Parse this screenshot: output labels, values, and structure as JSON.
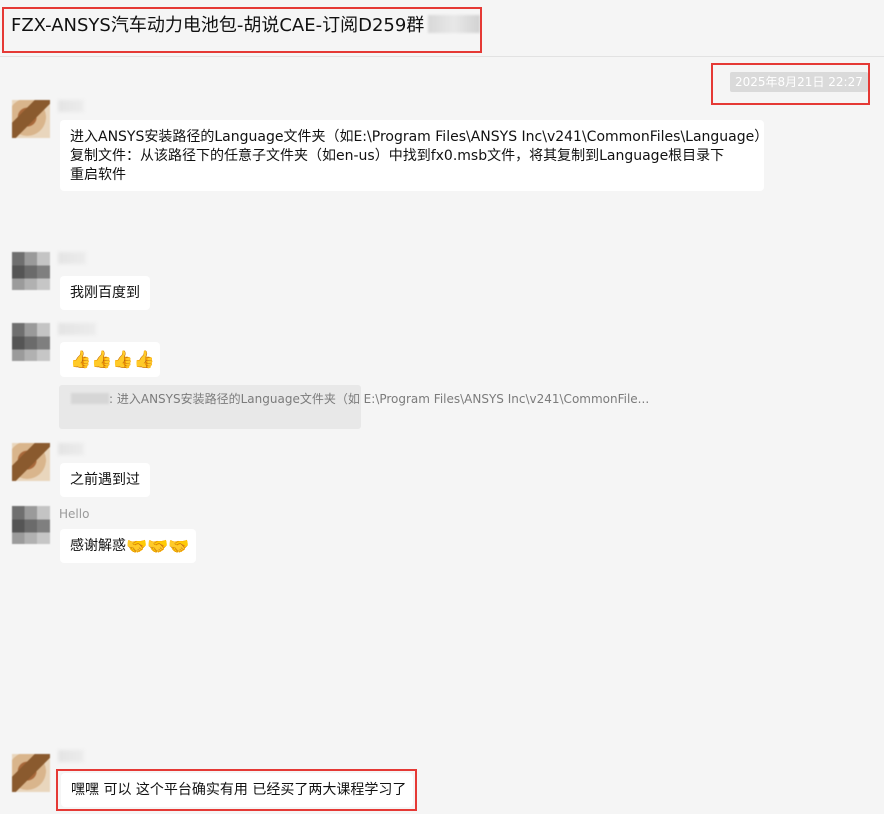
{
  "header": {
    "title": "FZX-ANSYS汽车动力电池包-胡说CAE-订阅D259群"
  },
  "timestamp": "2025年8月21日 22:27",
  "messages": [
    {
      "lines": [
        "进入ANSYS安装路径的Language文件夹（如E:\\Program Files\\ANSYS Inc\\v241\\CommonFiles\\Language）",
        "复制文件：从该路径下的任意子文件夹（如en-us）中找到fx0.msb文件，将其复制到Language根目录下",
        "重启软件"
      ]
    },
    {
      "text": "我刚百度到"
    },
    {
      "emoji": "👍👍👍👍",
      "quote": {
        "line1": ": 进入ANSYS安装路径的Language文件夹（如",
        "line2": "E:\\Program Files\\ANSYS Inc\\v241\\CommonFile..."
      }
    },
    {
      "text": "之前遇到过"
    },
    {
      "sender": "Hello",
      "text": "感谢解惑",
      "emoji": "🤝🤝🤝"
    },
    {
      "text": "嘿嘿 可以 这个平台确实有用 已经买了两大课程学习了"
    }
  ],
  "colors": {
    "highlight": "#e53935",
    "background": "#f5f5f5",
    "bubble": "#ffffff",
    "quote": "#e8e8e8"
  }
}
